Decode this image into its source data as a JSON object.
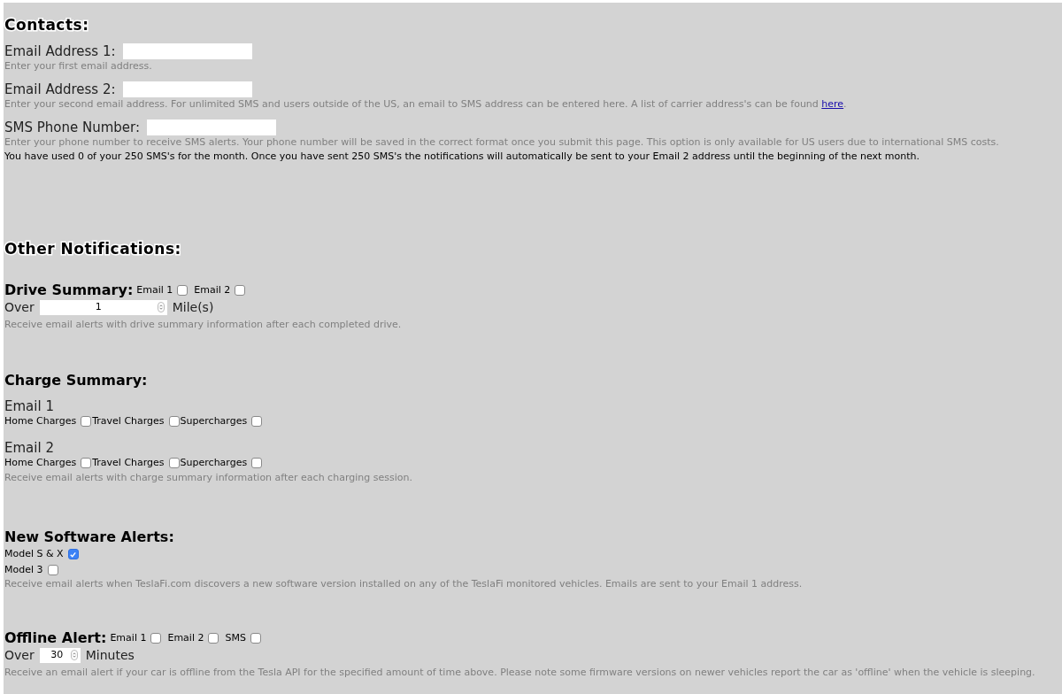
{
  "contacts": {
    "title": "Contacts:",
    "fields": [
      {
        "label": "Email Address 1:",
        "hint": "Enter your first email address."
      },
      {
        "label": "Email Address 2:",
        "hint": "Enter your second email address. For unlimited SMS and users outside of the US, an email to SMS address can be entered here. A list of carrier address's can be found",
        "link": "here",
        "hint_end": "."
      },
      {
        "label": "SMS Phone Number:",
        "hint": "Enter your phone number to receive SMS alerts. Your phone number will be saved in the correct format once you submit this page. This option is only available for US users due to international SMS costs."
      }
    ],
    "usage": "You have used 0 of your 250 SMS's for the month. Once you have sent 250 SMS's the notifications will automatically be sent to your Email 2 address until the beginning of the next month."
  },
  "other": {
    "title": "Other Notifications:",
    "drive": {
      "title": "Drive Summary:",
      "options": [
        {
          "label": "Email 1",
          "checked": false
        },
        {
          "label": "Email 2",
          "checked": false
        }
      ],
      "threshold": {
        "prefix": "Over",
        "value": "1",
        "suffix": "Mile(s)"
      },
      "hint": "Receive email alerts with drive summary information after each completed drive."
    },
    "charge": {
      "title": "Charge Summary:",
      "groups": [
        {
          "label": "Email 1",
          "options": [
            {
              "label": "Home Charges",
              "checked": false
            },
            {
              "label": "Travel Charges",
              "checked": false
            },
            {
              "label": "Supercharges",
              "checked": false
            }
          ]
        },
        {
          "label": "Email 2",
          "options": [
            {
              "label": "Home Charges",
              "checked": false
            },
            {
              "label": "Travel Charges",
              "checked": false
            },
            {
              "label": "Supercharges",
              "checked": false
            }
          ]
        }
      ],
      "hint": "Receive email alerts with charge summary information after each charging session."
    },
    "software": {
      "title": "New Software Alerts:",
      "options": [
        {
          "label": "Model S & X",
          "checked": true
        },
        {
          "label": "Model 3",
          "checked": false
        }
      ],
      "hint": "Receive email alerts when TeslaFi.com discovers a new software version installed on any of the TeslaFi monitored vehicles. Emails are sent to your Email 1 address."
    },
    "offline": {
      "title": "Offline Alert:",
      "options": [
        {
          "label": "Email 1",
          "checked": false
        },
        {
          "label": "Email 2",
          "checked": false
        },
        {
          "label": "SMS",
          "checked": false
        }
      ],
      "threshold": {
        "prefix": "Over",
        "value": "30",
        "suffix": "Minutes"
      },
      "hint": "Receive an email alert if your car is offline from the Tesla API for the specified amount of time above. Please note some firmware versions on newer vehicles report the car as 'offline' when the vehicle is sleeping."
    }
  }
}
